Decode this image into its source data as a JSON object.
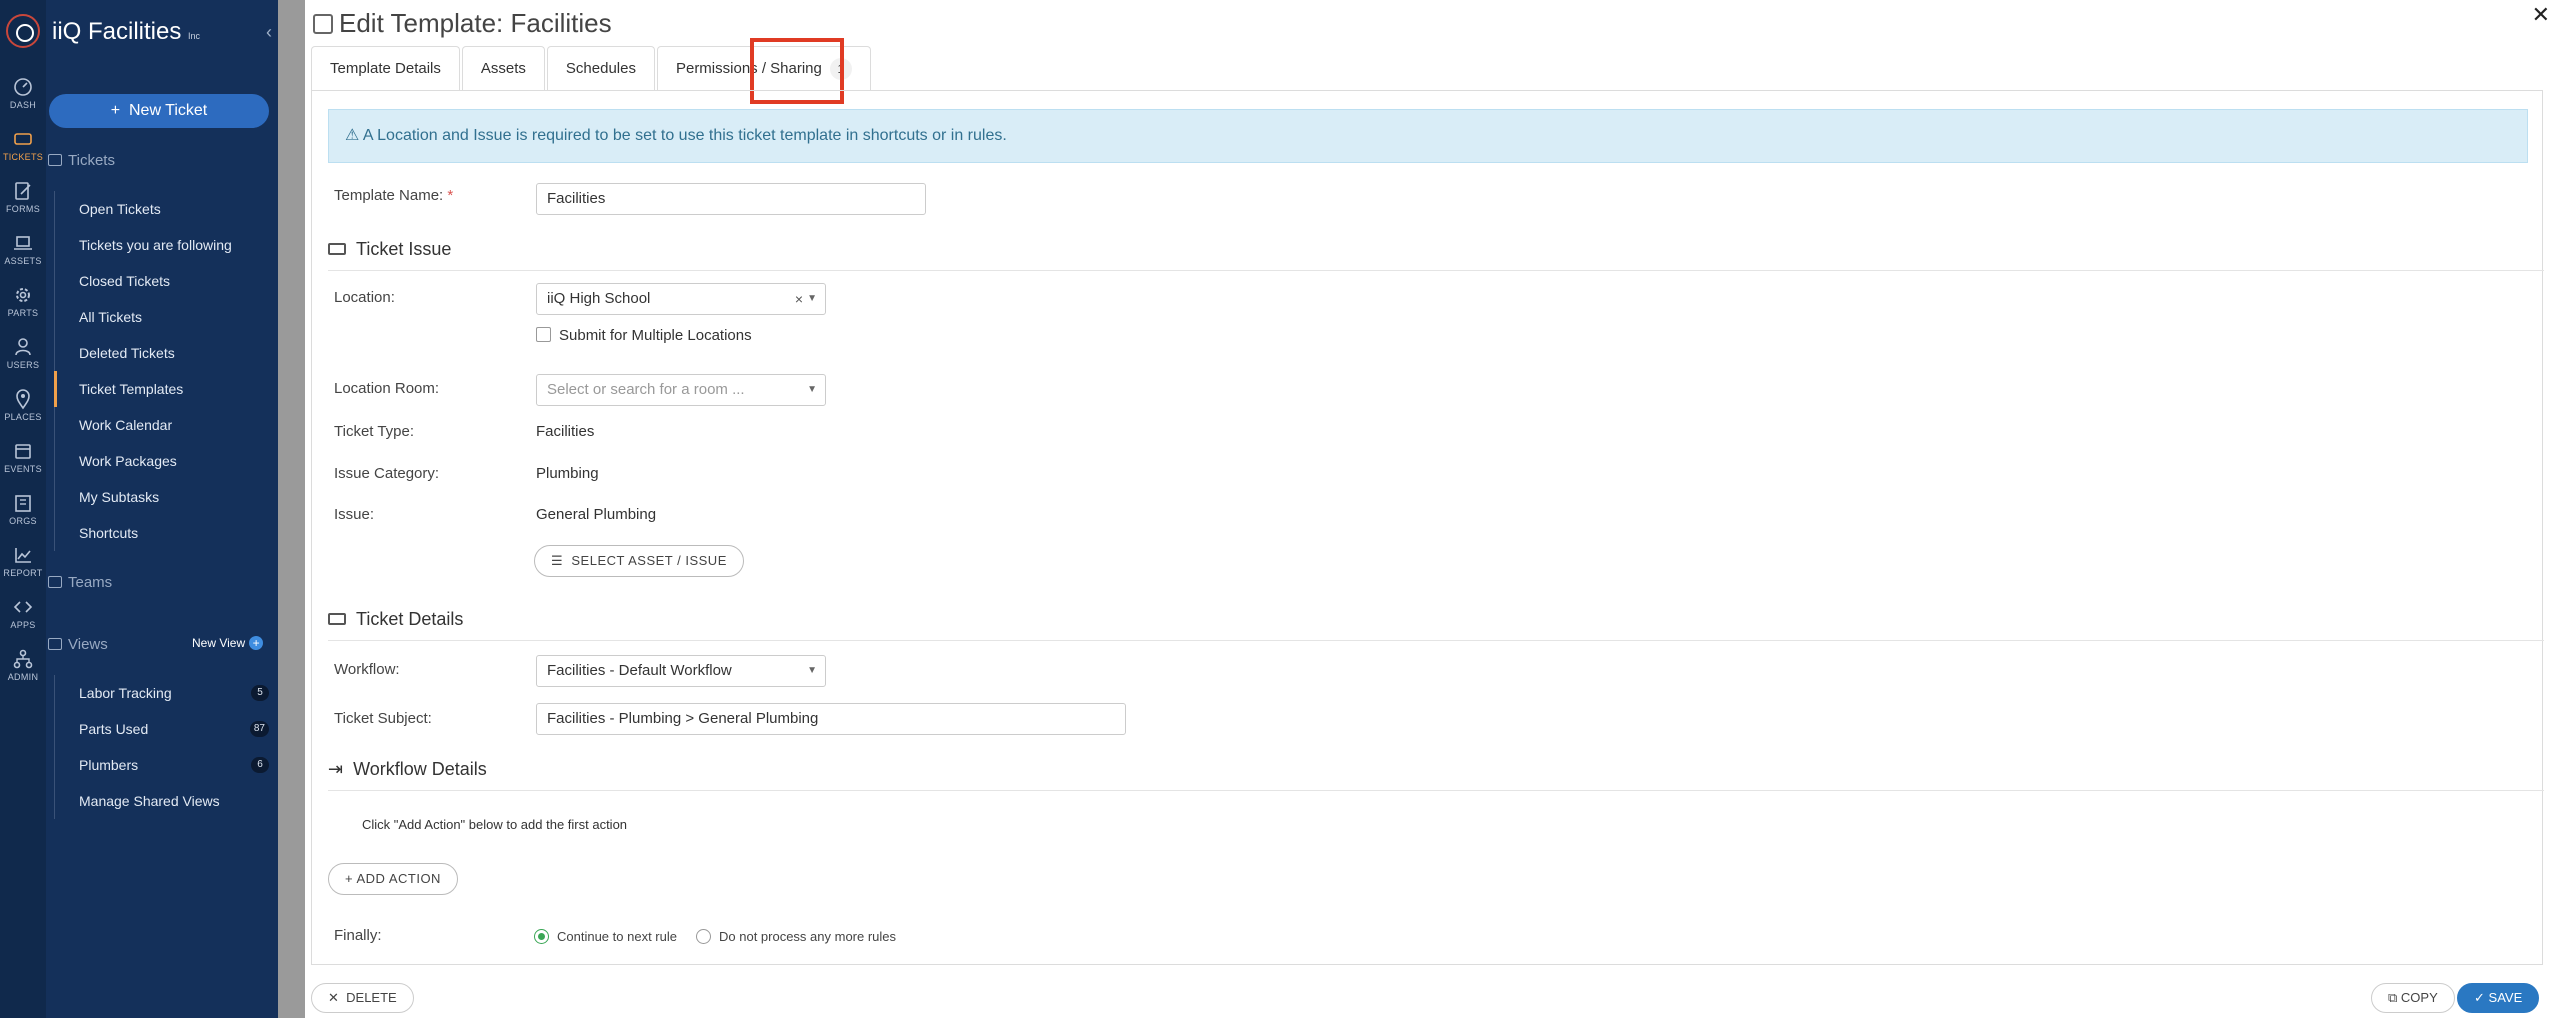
{
  "app": {
    "brand": "iiQ Facilities",
    "brand_suffix": "Inc"
  },
  "rail": [
    {
      "label": "DASH",
      "icon": "dashboard-icon"
    },
    {
      "label": "TICKETS",
      "icon": "ticket-icon"
    },
    {
      "label": "FORMS",
      "icon": "form-icon"
    },
    {
      "label": "ASSETS",
      "icon": "laptop-icon"
    },
    {
      "label": "PARTS",
      "icon": "gear-icon"
    },
    {
      "label": "USERS",
      "icon": "user-icon"
    },
    {
      "label": "PLACES",
      "icon": "map-pin-icon"
    },
    {
      "label": "EVENTS",
      "icon": "calendar-icon"
    },
    {
      "label": "ORGS",
      "icon": "building-icon"
    },
    {
      "label": "REPORT",
      "icon": "chart-icon"
    },
    {
      "label": "APPS",
      "icon": "code-icon"
    },
    {
      "label": "ADMIN",
      "icon": "sitemap-icon"
    }
  ],
  "nav": {
    "new_ticket": "New Ticket",
    "tickets_section": "Tickets",
    "ticket_links": [
      "Open Tickets",
      "Tickets you are following",
      "Closed Tickets",
      "All Tickets",
      "Deleted Tickets",
      "Ticket Templates",
      "Work Calendar",
      "Work Packages",
      "My Subtasks",
      "Shortcuts"
    ],
    "teams_section": "Teams",
    "views_section": "Views",
    "new_view": "New View",
    "views": [
      {
        "label": "Labor Tracking",
        "count": "5"
      },
      {
        "label": "Parts Used",
        "count": "87"
      },
      {
        "label": "Plumbers",
        "count": "6"
      },
      {
        "label": "Manage Shared Views",
        "count": ""
      }
    ]
  },
  "panel": {
    "title": "Edit Template: Facilities",
    "tabs": [
      {
        "label": "Template Details"
      },
      {
        "label": "Assets"
      },
      {
        "label": "Schedules"
      },
      {
        "label": "Permissions / Sharing",
        "count": "1"
      }
    ],
    "alert": "⚠ A Location and Issue is required to be set to use this ticket template in shortcuts or in rules.",
    "template_name_label": "Template Name:",
    "template_name_value": "Facilities",
    "ticket_issue_heading": "Ticket Issue",
    "location_label": "Location:",
    "location_value": "iiQ High School",
    "multi_location_label": "Submit for Multiple Locations",
    "location_room_label": "Location Room:",
    "location_room_placeholder": "Select or search for a room ...",
    "ticket_type_label": "Ticket Type:",
    "ticket_type_value": "Facilities",
    "issue_category_label": "Issue Category:",
    "issue_category_value": "Plumbing",
    "issue_label": "Issue:",
    "issue_value": "General Plumbing",
    "select_asset_issue": "SELECT ASSET / ISSUE",
    "ticket_details_heading": "Ticket Details",
    "workflow_label": "Workflow:",
    "workflow_value": "Facilities - Default Workflow",
    "ticket_subject_label": "Ticket Subject:",
    "ticket_subject_value": "Facilities - Plumbing > General Plumbing",
    "workflow_details_heading": "Workflow Details",
    "workflow_hint": "Click \"Add Action\" below to add the first action",
    "add_action": "+ ADD ACTION",
    "finally_label": "Finally:",
    "finally_options": [
      "Continue to next rule",
      "Do not process any more rules"
    ],
    "delete": "DELETE",
    "copy": "COPY",
    "save": "SAVE"
  },
  "colors": {
    "sidebar": "#14305a",
    "accent": "#2a78c2",
    "highlight": "#e03b24"
  }
}
